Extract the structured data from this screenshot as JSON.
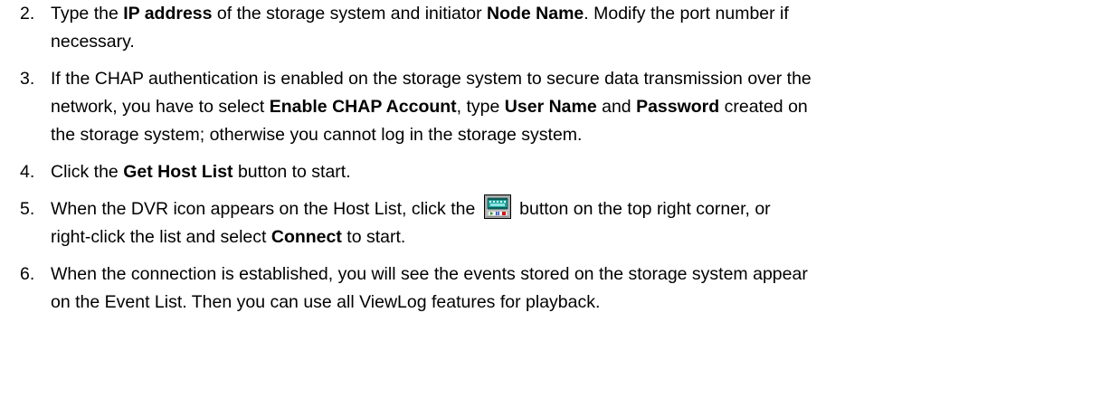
{
  "steps": [
    {
      "number": "2.",
      "lines": [
        [
          "Type the ",
          {
            "b": "IP address"
          },
          " of the storage system and initiator ",
          {
            "b": "Node Name"
          },
          ". Modify the port number if"
        ],
        [
          "necessary."
        ]
      ]
    },
    {
      "number": "3.",
      "lines": [
        [
          "If the CHAP authentication is enabled on the storage system to secure data transmission over the"
        ],
        [
          "network, you have to select ",
          {
            "b": "Enable CHAP Account"
          },
          ", type ",
          {
            "b": "User Name"
          },
          " and ",
          {
            "b": "Password"
          },
          " created on"
        ],
        [
          "the storage system; otherwise you cannot log in the storage system."
        ]
      ]
    },
    {
      "number": "4.",
      "lines": [
        [
          "Click the ",
          {
            "b": "Get Host List"
          },
          " button to start."
        ]
      ]
    },
    {
      "number": "5.",
      "lines": [
        [
          "When the DVR icon appears on the Host List, click the ",
          {
            "icon": "dvr-connect-icon"
          },
          " button on the top right corner, or"
        ],
        [
          "right-click the list and select ",
          {
            "b": "Connect"
          },
          " to start."
        ]
      ]
    },
    {
      "number": "6.",
      "lines": [
        [
          "When the connection is established, you will see the events stored on the storage system appear"
        ],
        [
          "on the Event List. Then you can use all ViewLog features for playback."
        ]
      ]
    }
  ]
}
